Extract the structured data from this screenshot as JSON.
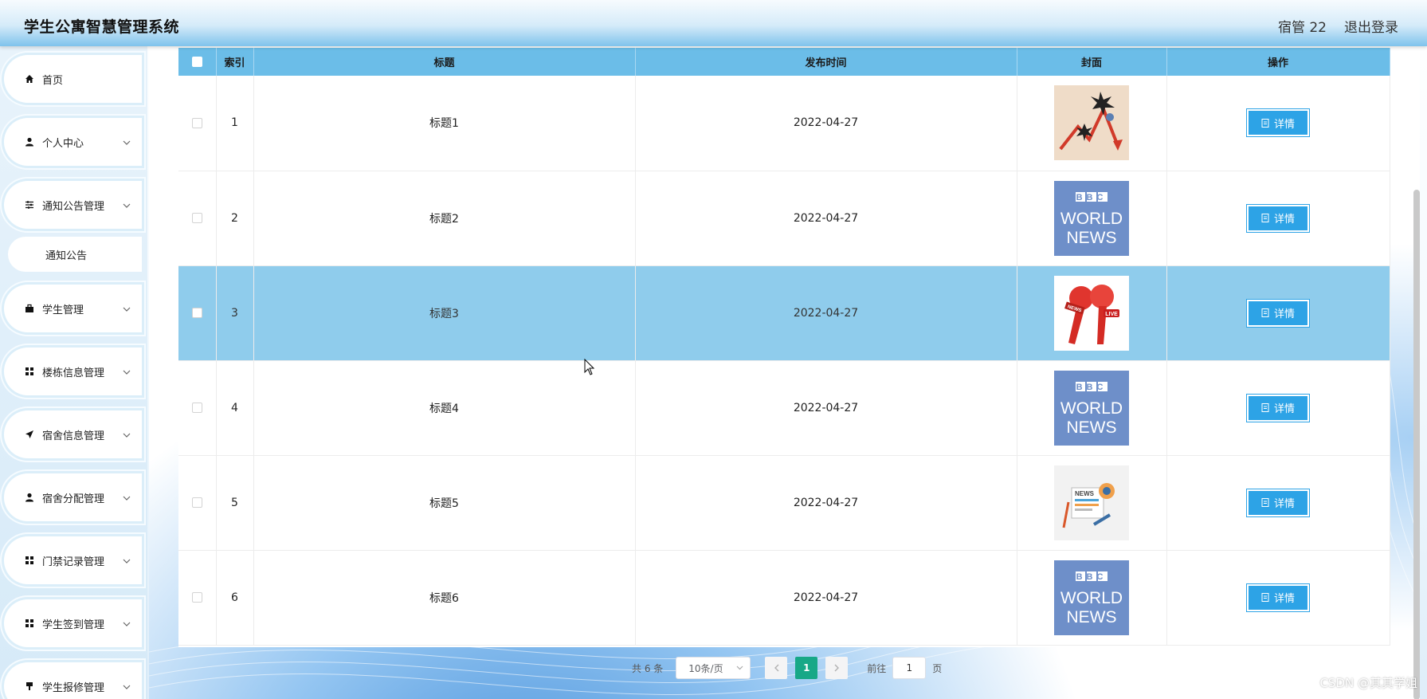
{
  "header": {
    "app_title": "学生公寓智慧管理系统",
    "user_label": "宿管 22",
    "logout_label": "退出登录"
  },
  "sidebar": {
    "items": [
      {
        "label": "首页",
        "icon": "home-icon"
      },
      {
        "label": "个人中心",
        "icon": "user-icon"
      },
      {
        "label": "通知公告管理",
        "icon": "sliders-icon"
      },
      {
        "label": "学生管理",
        "icon": "briefcase-icon"
      },
      {
        "label": "楼栋信息管理",
        "icon": "grid-icon"
      },
      {
        "label": "宿舍信息管理",
        "icon": "send-icon"
      },
      {
        "label": "宿舍分配管理",
        "icon": "user-icon"
      },
      {
        "label": "门禁记录管理",
        "icon": "grid-icon"
      },
      {
        "label": "学生签到管理",
        "icon": "grid-icon"
      },
      {
        "label": "学生报修管理",
        "icon": "tool-icon"
      }
    ],
    "submenu": {
      "label": "通知公告"
    }
  },
  "table": {
    "columns": [
      "索引",
      "标题",
      "发布时间",
      "封面",
      "操作"
    ],
    "rows": [
      {
        "index": "1",
        "title": "标题1",
        "date": "2022-04-27",
        "cover": "chart-explosion"
      },
      {
        "index": "2",
        "title": "标题2",
        "date": "2022-04-27",
        "cover": "bbc-world-news"
      },
      {
        "index": "3",
        "title": "标题3",
        "date": "2022-04-27",
        "cover": "news-microphones"
      },
      {
        "index": "4",
        "title": "标题4",
        "date": "2022-04-27",
        "cover": "bbc-world-news"
      },
      {
        "index": "5",
        "title": "标题5",
        "date": "2022-04-27",
        "cover": "news-illustration"
      },
      {
        "index": "6",
        "title": "标题6",
        "date": "2022-04-27",
        "cover": "bbc-world-news"
      }
    ],
    "detail_label": "详情",
    "highlighted_row": 3
  },
  "covers": {
    "bbc_top": "BBC",
    "bbc_mid": "WORLD",
    "bbc_bot": "NEWS",
    "mic_tag": "NEWS",
    "mic_live": "LIVE",
    "news_tag": "NEWS"
  },
  "pagination": {
    "total": "共 6 条",
    "page_size": "10条/页",
    "current_page": "1",
    "goto_prefix": "前往",
    "goto_value": "1",
    "goto_suffix": "页"
  },
  "watermark": "CSDN @其其学姐",
  "colors": {
    "header_accent": "#7fc3ec",
    "table_header": "#6bbde8",
    "highlight_row": "#8fccec",
    "detail_button": "#2da3e6",
    "pager_active": "#17a887"
  }
}
